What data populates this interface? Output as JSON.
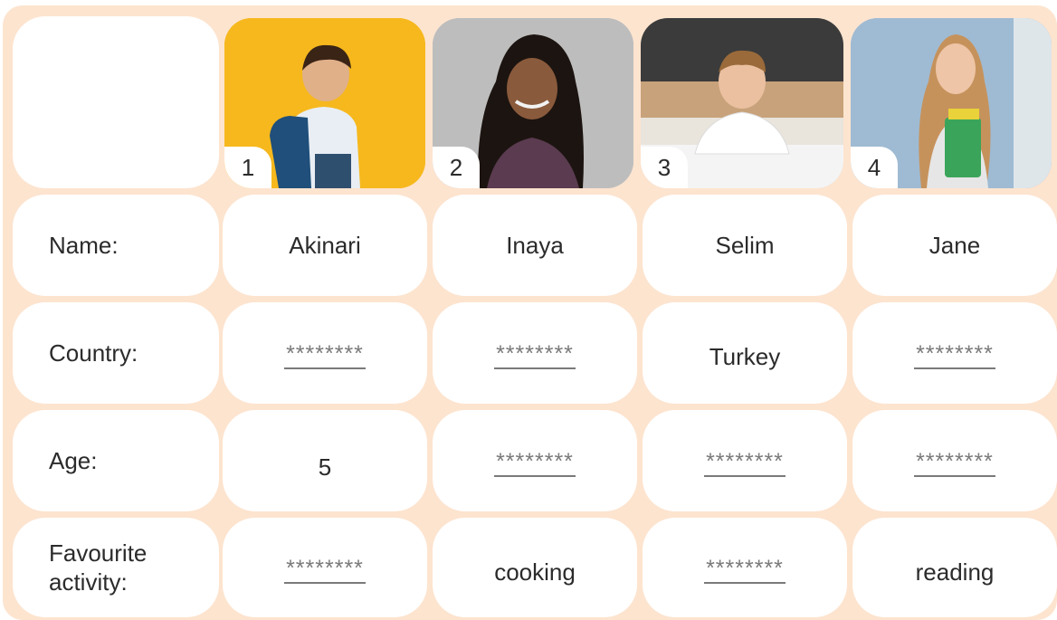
{
  "columns": [
    {
      "number": "1",
      "name": "Akinari",
      "country": null,
      "age": "5",
      "activity": null
    },
    {
      "number": "2",
      "name": "Inaya",
      "country": null,
      "age": null,
      "activity": "cooking"
    },
    {
      "number": "3",
      "name": "Selim",
      "country": "Turkey",
      "age": null,
      "activity": null
    },
    {
      "number": "4",
      "name": "Jane",
      "country": null,
      "age": null,
      "activity": "reading"
    }
  ],
  "row_labels": {
    "name": "Name:",
    "country": "Country:",
    "age": "Age:",
    "activity": "Favourite\nactivity:"
  },
  "blank_placeholder": "********",
  "colors": {
    "board_background": "#fde4cf",
    "card_background": "#ffffff",
    "blank_text": "#7a7a7a"
  },
  "photos": [
    {
      "icon": "boy-with-backpack-photo",
      "background": "#f6b81d"
    },
    {
      "icon": "young-woman-portrait-photo",
      "background": "#b9b9b9"
    },
    {
      "icon": "boy-at-desk-photo",
      "background": "#cdb9a0"
    },
    {
      "icon": "girl-holding-books-photo",
      "background": "#9fbbd3"
    }
  ]
}
